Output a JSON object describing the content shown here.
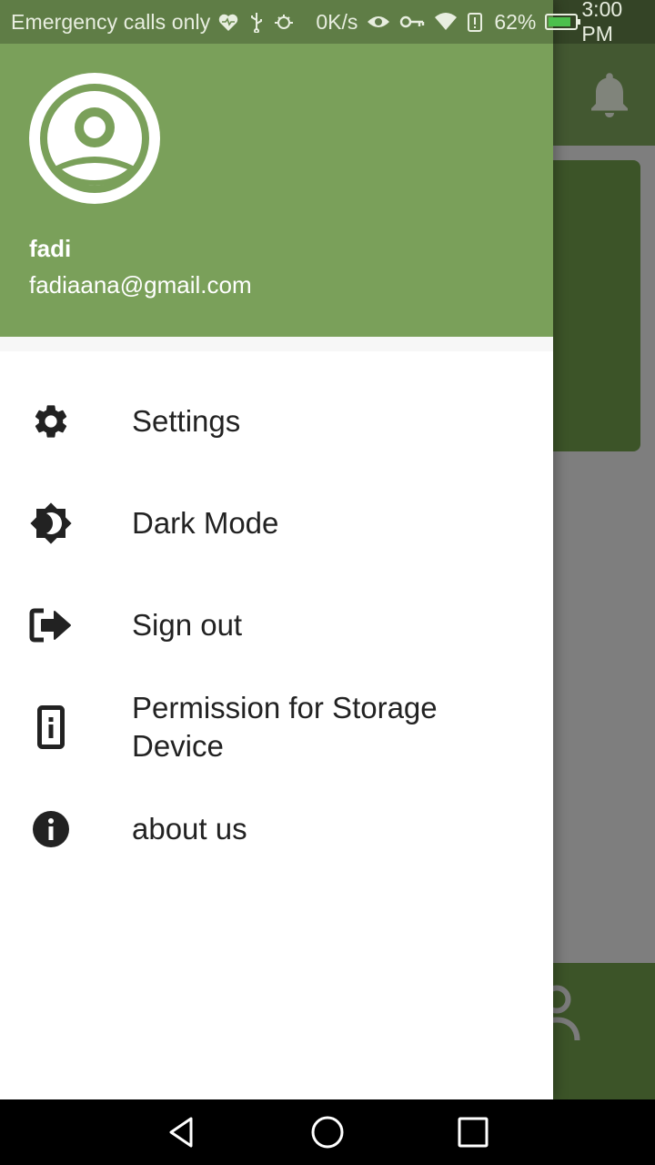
{
  "status_bar": {
    "carrier": "Emergency calls only",
    "speed": "0K/s",
    "battery_percent": "62%",
    "time": "3:00 PM",
    "icons": [
      "heartbeat-icon",
      "usb-icon",
      "debug-icon",
      "eye-icon",
      "key-icon",
      "wifi-icon",
      "battery-alert-icon",
      "battery-icon"
    ]
  },
  "drawer": {
    "header": {
      "avatar_icon": "account-circle-icon",
      "user_name": "fadi",
      "user_email": "fadiaana@gmail.com",
      "background_color": "#7aa05a"
    },
    "menu": [
      {
        "label": "Settings",
        "icon": "gear-icon"
      },
      {
        "label": "Dark Mode",
        "icon": "brightness-icon"
      },
      {
        "label": "Sign out",
        "icon": "sign-out-icon"
      },
      {
        "label": "Permission for Storage Device",
        "icon": "storage-device-icon"
      },
      {
        "label": "about us",
        "icon": "info-icon"
      }
    ]
  },
  "background_app": {
    "accent_color": "#6e9a4a",
    "toolbar_icon": "bell-icon",
    "bottom_icon": "person-icon"
  },
  "nav_bar": {
    "buttons": [
      "back-button",
      "home-button",
      "recents-button"
    ]
  }
}
